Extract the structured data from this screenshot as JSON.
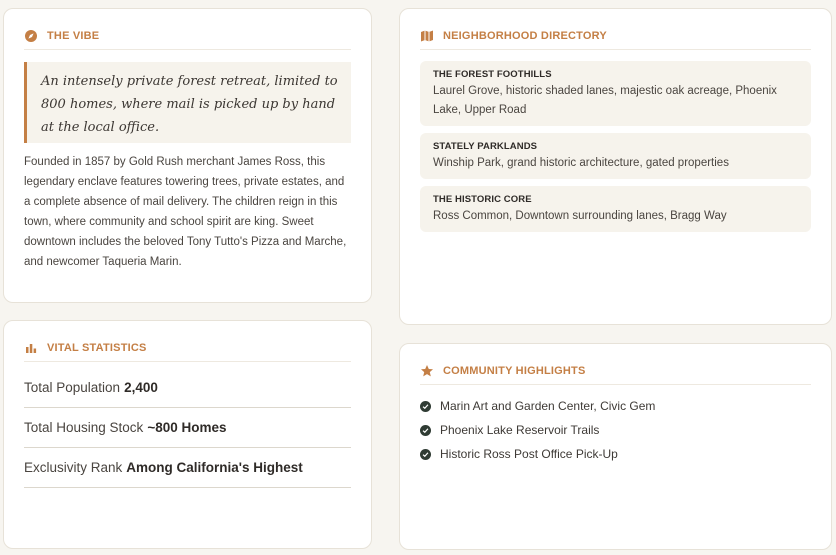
{
  "vibe": {
    "title": "THE VIBE",
    "icon": "compass-icon",
    "quote": "An intensely private forest retreat, limited to 800 homes, where mail is picked up by hand at the local office.",
    "body": "Founded in 1857 by Gold Rush merchant James Ross, this legendary enclave features towering trees, private estates, and a complete absence of mail delivery. The children reign in this town, where community and school spirit are king. Sweet downtown includes the beloved Tony Tutto's Pizza and Marche, and newcomer Taqueria Marin."
  },
  "stats": {
    "title": "VITAL STATISTICS",
    "icon": "bar-chart-icon",
    "rows": [
      {
        "label": "Total Population",
        "value": "2,400"
      },
      {
        "label": "Total Housing Stock",
        "value": "~800 Homes"
      },
      {
        "label": "Exclusivity Rank",
        "value": "Among California's Highest"
      }
    ]
  },
  "directory": {
    "title": "NEIGHBORHOOD DIRECTORY",
    "icon": "map-icon",
    "items": [
      {
        "name": "THE FOREST FOOTHILLS",
        "desc": "Laurel Grove, historic shaded lanes, majestic oak acreage, Phoenix Lake, Upper Road"
      },
      {
        "name": "STATELY PARKLANDS",
        "desc": "Winship Park, grand historic architecture, gated properties"
      },
      {
        "name": "THE HISTORIC CORE",
        "desc": "Ross Common, Downtown surrounding lanes, Bragg Way"
      }
    ]
  },
  "highlights": {
    "title": "COMMUNITY HIGHLIGHTS",
    "icon": "star-icon",
    "items": [
      "Marin Art and Garden Center, Civic Gem",
      "Phoenix Lake Reservoir Trails",
      "Historic Ross Post Office Pick-Up"
    ]
  },
  "colors": {
    "accent": "#c47f45",
    "background": "#f7f5f0",
    "check": "#2f3b33"
  }
}
